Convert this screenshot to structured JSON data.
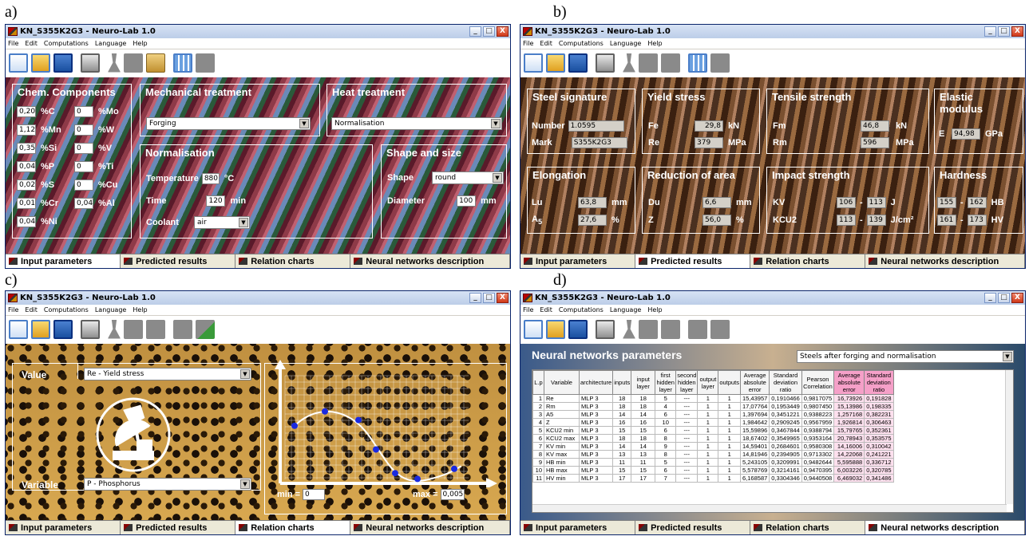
{
  "labels": {
    "a": "a)",
    "b": "b)",
    "c": "c)",
    "d": "d)"
  },
  "window": {
    "title": "KN_S355K2G3 - Neuro-Lab 1.0",
    "min": "_",
    "max": "□",
    "close": "X"
  },
  "menu": {
    "file": "File",
    "edit": "Edit",
    "computations": "Computations",
    "language": "Language",
    "help": "Help"
  },
  "tabs": {
    "input": "Input parameters",
    "predicted": "Predicted results",
    "relation": "Relation charts",
    "nn": "Neural networks description"
  },
  "a": {
    "chem_title": "Chem. Components",
    "left": [
      {
        "v": "0,20",
        "s": "%C"
      },
      {
        "v": "1,12",
        "s": "%Mn"
      },
      {
        "v": "0,35",
        "s": "%Si"
      },
      {
        "v": "0,04",
        "s": "%P"
      },
      {
        "v": "0,02",
        "s": "%S"
      },
      {
        "v": "0,01",
        "s": "%Cr"
      },
      {
        "v": "0,04",
        "s": "%Ni"
      }
    ],
    "right": [
      {
        "v": "0",
        "s": "%Mo"
      },
      {
        "v": "0",
        "s": "%W"
      },
      {
        "v": "0",
        "s": "%V"
      },
      {
        "v": "0",
        "s": "%Ti"
      },
      {
        "v": "0",
        "s": "%Cu"
      },
      {
        "v": "0,04",
        "s": "%Al"
      }
    ],
    "mech_title": "Mechanical treatment",
    "mech_value": "Forging",
    "heat_title": "Heat treatment",
    "heat_value": "Normalisation",
    "norm_title": "Normalisation",
    "temp_label": "Temperature",
    "temp_value": "880",
    "temp_unit": "°C",
    "time_label": "Time",
    "time_value": "120",
    "time_unit": "min",
    "coolant_label": "Coolant",
    "coolant_value": "air",
    "shape_title": "Shape and size",
    "shape_label": "Shape",
    "shape_value": "round",
    "diam_label": "Diameter",
    "diam_value": "100",
    "diam_unit": "mm"
  },
  "b": {
    "sig_title": "Steel signature",
    "number_label": "Number",
    "number_value": "1.0595",
    "mark_label": "Mark",
    "mark_value": "S355K2G3",
    "ys_title": "Yield stress",
    "fe_label": "Fe",
    "fe_value": "29,8",
    "fe_unit": "kN",
    "re_label": "Re",
    "re_value": "379",
    "re_unit": "MPa",
    "ts_title": "Tensile strength",
    "fm_label": "Fm",
    "fm_value": "46,8",
    "fm_unit": "kN",
    "rm_label": "Rm",
    "rm_value": "596",
    "rm_unit": "MPa",
    "em_title": "Elastic modulus",
    "e_label": "E",
    "e_value": "94,98",
    "e_unit": "GPa",
    "el_title": "Elongation",
    "lu_label": "Lu",
    "lu_value": "63,8",
    "lu_unit": "mm",
    "a5_label": "A",
    "a5_sub": "5",
    "a5_value": "27,6",
    "a5_unit": "%",
    "ra_title": "Reduction of area",
    "du_label": "Du",
    "du_value": "6,6",
    "du_unit": "mm",
    "z_label": "Z",
    "z_value": "56,0",
    "z_unit": "%",
    "is_title": "Impact strength",
    "kv_label": "KV",
    "kv_min": "106",
    "kv_max": "113",
    "kv_unit": "J",
    "kcu_label": "KCU2",
    "kcu_min": "113",
    "kcu_max": "139",
    "kcu_unit": "J/cm²",
    "h_title": "Hardness",
    "hb_min": "155",
    "hb_max": "162",
    "hb_unit": "HB",
    "hv_min": "161",
    "hv_max": "173",
    "hv_unit": "HV",
    "dash": "-"
  },
  "c": {
    "value_label": "Value",
    "value_select": "Re - Yield stress",
    "variable_label": "Variable",
    "variable_select": "P - Phosphorus",
    "min_label": "min =",
    "min_value": "0",
    "max_label": "max =",
    "max_value": "0,005"
  },
  "d": {
    "title": "Neural networks parameters",
    "select": "Steels after forging and normalisation",
    "headers": [
      "L.p",
      "Variable",
      "architecture",
      "inputs",
      "input layer",
      "first hidden layer",
      "second hidden layer",
      "output layer",
      "outputs",
      "Average absolute error",
      "Standard deviation ratio",
      "Pearson Correlation",
      "Average absolute error",
      "Standard deviation ratio"
    ],
    "rows": [
      [
        "1",
        "Re",
        "MLP 3",
        "18",
        "18",
        "5",
        "---",
        "1",
        "1",
        "15,43957",
        "0,1910466",
        "0,9817075",
        "16,73926",
        "0,191828"
      ],
      [
        "2",
        "Rm",
        "MLP 3",
        "18",
        "18",
        "4",
        "---",
        "1",
        "1",
        "17,07764",
        "0,1953449",
        "0,9807450",
        "15,13986",
        "0,198335"
      ],
      [
        "3",
        "A5",
        "MLP 3",
        "14",
        "14",
        "6",
        "---",
        "1",
        "1",
        "1,397694",
        "0,3451221",
        "0,9388223",
        "1,257168",
        "0,382231"
      ],
      [
        "4",
        "Z",
        "MLP 3",
        "16",
        "16",
        "10",
        "---",
        "1",
        "1",
        "1,984642",
        "0,2909245",
        "0,9567959",
        "1,926814",
        "0,306463"
      ],
      [
        "5",
        "KCU2 min",
        "MLP 3",
        "15",
        "15",
        "6",
        "---",
        "1",
        "1",
        "15,59896",
        "0,3467844",
        "0,9388794",
        "15,79765",
        "0,352361"
      ],
      [
        "6",
        "KCU2 max",
        "MLP 3",
        "18",
        "18",
        "8",
        "---",
        "1",
        "1",
        "18,67402",
        "0,3549965",
        "0,9353164",
        "20,78943",
        "0,353575"
      ],
      [
        "7",
        "KV min",
        "MLP 3",
        "14",
        "14",
        "9",
        "---",
        "1",
        "1",
        "14,59401",
        "0,2684601",
        "0,9580308",
        "14,16006",
        "0,310042"
      ],
      [
        "8",
        "KV max",
        "MLP 3",
        "13",
        "13",
        "8",
        "---",
        "1",
        "1",
        "14,81946",
        "0,2394905",
        "0,9713302",
        "14,22068",
        "0,241221"
      ],
      [
        "9",
        "HB min",
        "MLP 3",
        "11",
        "11",
        "5",
        "---",
        "1",
        "1",
        "5,243105",
        "0,3209991",
        "0,9482644",
        "5,595888",
        "0,336712"
      ],
      [
        "10",
        "HB max",
        "MLP 3",
        "15",
        "15",
        "6",
        "---",
        "1",
        "1",
        "5,578769",
        "0,3214161",
        "0,9470395",
        "6,003226",
        "0,320785"
      ],
      [
        "11",
        "HV min",
        "MLP 3",
        "17",
        "17",
        "7",
        "---",
        "1",
        "1",
        "6,168587",
        "0,3304346",
        "0,9440508",
        "6,469032",
        "0,341486"
      ]
    ]
  }
}
